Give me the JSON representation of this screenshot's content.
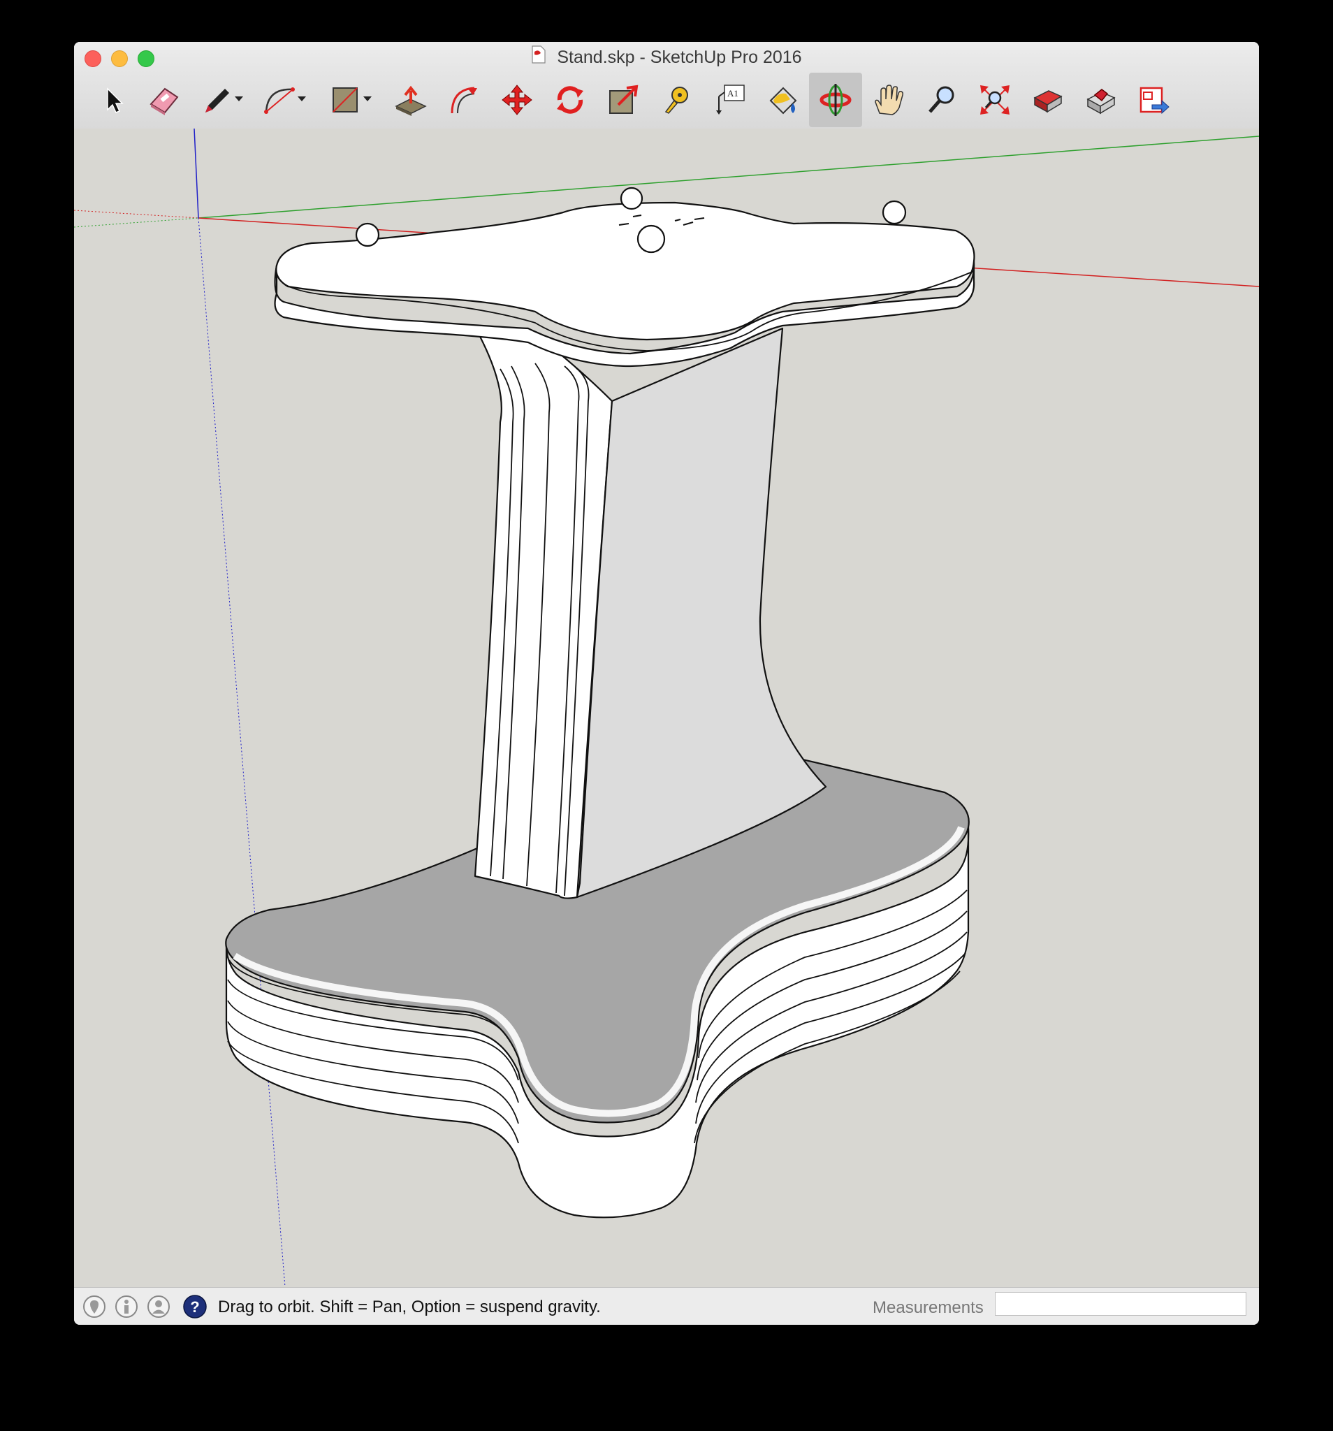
{
  "window": {
    "title": "Stand.skp - SketchUp Pro 2016"
  },
  "toolbar": {
    "tools": [
      {
        "name": "Select",
        "icon": "arrow-pointer-icon"
      },
      {
        "name": "Eraser",
        "icon": "eraser-icon"
      },
      {
        "name": "Line",
        "icon": "pencil-icon"
      },
      {
        "name": "Arc",
        "icon": "arc-icon"
      },
      {
        "name": "Rectangle",
        "icon": "rectangle-icon"
      },
      {
        "name": "Push/Pull",
        "icon": "push-pull-icon"
      },
      {
        "name": "Offset",
        "icon": "offset-icon"
      },
      {
        "name": "Move",
        "icon": "move-icon"
      },
      {
        "name": "Rotate",
        "icon": "rotate-icon"
      },
      {
        "name": "Scale",
        "icon": "scale-icon"
      },
      {
        "name": "Tape Measure",
        "icon": "tape-measure-icon"
      },
      {
        "name": "Text",
        "icon": "text-icon",
        "label": "A1"
      },
      {
        "name": "Paint Bucket",
        "icon": "paint-bucket-icon"
      },
      {
        "name": "Orbit",
        "icon": "orbit-icon",
        "active": true
      },
      {
        "name": "Pan",
        "icon": "pan-hand-icon"
      },
      {
        "name": "Zoom",
        "icon": "zoom-icon"
      },
      {
        "name": "Zoom Extents",
        "icon": "zoom-extents-icon"
      },
      {
        "name": "3D Warehouse",
        "icon": "warehouse-icon"
      },
      {
        "name": "Extension Warehouse",
        "icon": "extension-warehouse-icon"
      },
      {
        "name": "Send to LayOut",
        "icon": "send-to-layout-icon"
      }
    ]
  },
  "status": {
    "message": "Drag to orbit. Shift = Pan, Option = suspend gravity."
  },
  "measurements": {
    "label": "Measurements",
    "value": ""
  },
  "colors": {
    "viewport_bg": "#d8d7d2",
    "axis_red": "#d22020",
    "axis_green": "#2ea02e",
    "axis_blue": "#2020c8",
    "model_face": "#ffffff",
    "model_shadow": "#a6a6a6"
  }
}
